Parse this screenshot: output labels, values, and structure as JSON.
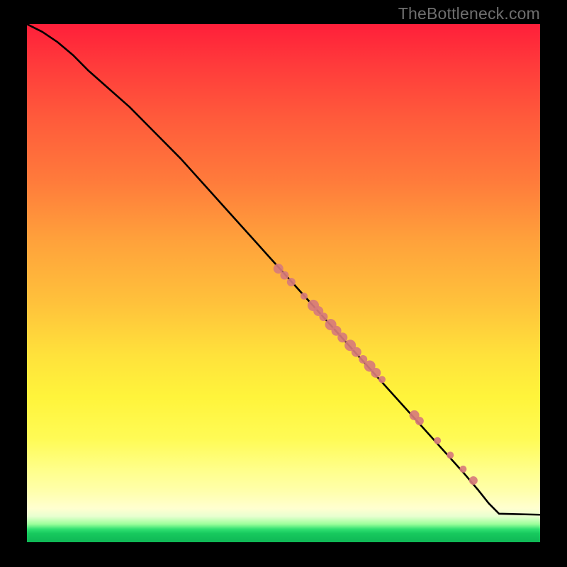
{
  "watermark": "TheBottleneck.com",
  "chart_data": {
    "type": "line",
    "title": "",
    "xlabel": "",
    "ylabel": "",
    "xlim": [
      0,
      100
    ],
    "ylim": [
      0,
      100
    ],
    "grid": false,
    "legend": false,
    "series": [
      {
        "name": "curve",
        "x": [
          0,
          3,
          6,
          9,
          12,
          16,
          20,
          25,
          30,
          35,
          40,
          45,
          50,
          55,
          60,
          65,
          70,
          75,
          80,
          85,
          88,
          90,
          92,
          100
        ],
        "y": [
          100,
          98.5,
          96.5,
          94,
          91,
          87.5,
          84,
          79,
          74,
          68.5,
          63,
          57.5,
          52,
          46.5,
          41,
          35.5,
          30,
          24.5,
          19,
          13.5,
          10,
          7.5,
          5.5,
          5.3
        ]
      }
    ],
    "markers": {
      "name": "highlight-points",
      "color": "#d77b7b",
      "points": [
        {
          "x": 49.0,
          "y": 52.8,
          "r": 7
        },
        {
          "x": 50.2,
          "y": 51.5,
          "r": 6
        },
        {
          "x": 51.5,
          "y": 50.2,
          "r": 6
        },
        {
          "x": 54.0,
          "y": 47.5,
          "r": 5
        },
        {
          "x": 55.8,
          "y": 45.7,
          "r": 8
        },
        {
          "x": 56.8,
          "y": 44.6,
          "r": 7
        },
        {
          "x": 57.8,
          "y": 43.5,
          "r": 6
        },
        {
          "x": 59.2,
          "y": 42.0,
          "r": 8
        },
        {
          "x": 60.3,
          "y": 40.8,
          "r": 7
        },
        {
          "x": 61.5,
          "y": 39.5,
          "r": 7
        },
        {
          "x": 63.0,
          "y": 38.0,
          "r": 8
        },
        {
          "x": 64.2,
          "y": 36.7,
          "r": 7
        },
        {
          "x": 65.5,
          "y": 35.3,
          "r": 6
        },
        {
          "x": 66.8,
          "y": 34.0,
          "r": 8
        },
        {
          "x": 68.0,
          "y": 32.7,
          "r": 7
        },
        {
          "x": 69.2,
          "y": 31.4,
          "r": 5
        },
        {
          "x": 75.5,
          "y": 24.5,
          "r": 7
        },
        {
          "x": 76.5,
          "y": 23.4,
          "r": 6
        },
        {
          "x": 80.0,
          "y": 19.6,
          "r": 5
        },
        {
          "x": 82.5,
          "y": 16.8,
          "r": 5
        },
        {
          "x": 85.0,
          "y": 14.1,
          "r": 5
        },
        {
          "x": 87.0,
          "y": 11.9,
          "r": 6
        }
      ]
    }
  }
}
